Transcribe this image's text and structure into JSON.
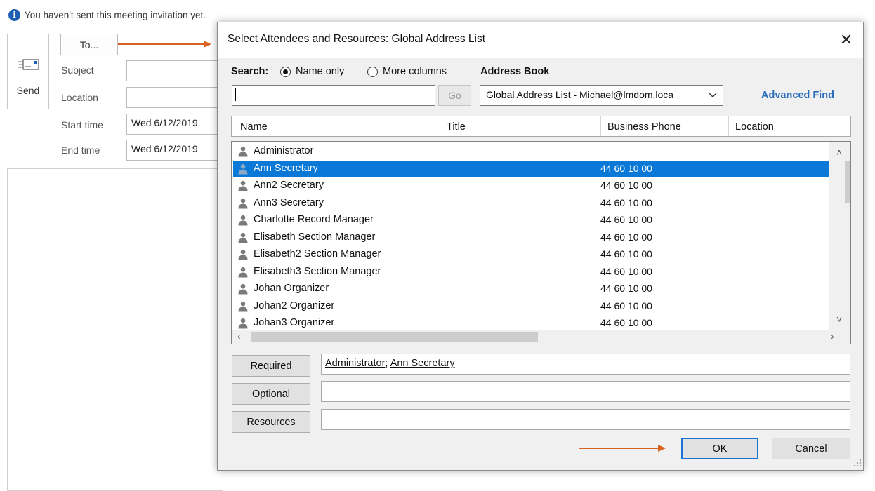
{
  "infobar": {
    "text": "You haven't sent this meeting invitation yet."
  },
  "form": {
    "send_label": "Send",
    "to_label": "To...",
    "subject_label": "Subject",
    "location_label": "Location",
    "start_time_label": "Start time",
    "start_time_value": "Wed 6/12/2019",
    "end_time_label": "End time",
    "end_time_value": "Wed 6/12/2019"
  },
  "dialog": {
    "title": "Select Attendees and Resources: Global Address List",
    "search_label": "Search:",
    "radio_name_only": "Name only",
    "radio_more_columns": "More columns",
    "address_book_label": "Address Book",
    "search_value": "",
    "go_label": "Go",
    "address_book_value": "Global Address List - Michael@lmdom.loca",
    "advanced_find": "Advanced Find",
    "columns": [
      "Name",
      "Title",
      "Business Phone",
      "Location"
    ],
    "rows": [
      {
        "name": "Administrator",
        "phone": ""
      },
      {
        "name": "Ann Secretary",
        "phone": "44 60 10 00"
      },
      {
        "name": "Ann2 Secretary",
        "phone": "44 60 10 00"
      },
      {
        "name": "Ann3 Secretary",
        "phone": "44 60 10 00"
      },
      {
        "name": "Charlotte Record Manager",
        "phone": "44 60 10 00"
      },
      {
        "name": "Elisabeth Section Manager",
        "phone": "44 60 10 00"
      },
      {
        "name": "Elisabeth2 Section Manager",
        "phone": "44 60 10 00"
      },
      {
        "name": "Elisabeth3 Section Manager",
        "phone": "44 60 10 00"
      },
      {
        "name": "Johan Organizer",
        "phone": "44 60 10 00"
      },
      {
        "name": "Johan2 Organizer",
        "phone": "44 60 10 00"
      },
      {
        "name": "Johan3 Organizer",
        "phone": "44 60 10 00"
      }
    ],
    "selected_row": "Ann Secretary",
    "required_label": "Required",
    "required_value_1": "Administrator",
    "required_separator": ";",
    "required_value_2": "Ann Secretary",
    "optional_label": "Optional",
    "optional_value": "",
    "resources_label": "Resources",
    "resources_value": "",
    "ok_label": "OK",
    "cancel_label": "Cancel"
  },
  "colors": {
    "accent": "#0a78d7",
    "arrow": "#d9621f",
    "link": "#2a6ebb",
    "info": "#1e5fb3"
  }
}
